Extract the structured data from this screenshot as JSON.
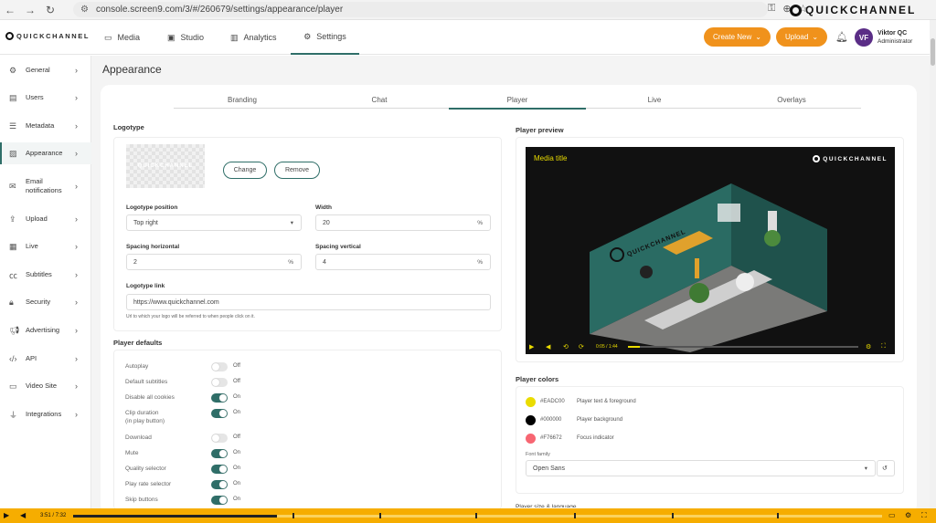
{
  "browser": {
    "url": "console.screen9.com/3/#/260679/settings/appearance/player",
    "watermark": "QUICKCHANNEL"
  },
  "brand": "QUICKCHANNEL",
  "nav": {
    "tabs": [
      "Media",
      "Studio",
      "Analytics",
      "Settings"
    ],
    "active": "Settings",
    "create": "Create New",
    "upload": "Upload"
  },
  "user": {
    "initials": "VF",
    "name": "Viktor QC",
    "role": "Administrator"
  },
  "sidebar": {
    "items": [
      {
        "label": "General",
        "icon": "gear-icon"
      },
      {
        "label": "Users",
        "icon": "users-icon"
      },
      {
        "label": "Metadata",
        "icon": "list-icon"
      },
      {
        "label": "Appearance",
        "icon": "image-icon"
      },
      {
        "label": "Email\nnotifications",
        "icon": "mail-icon"
      },
      {
        "label": "Upload",
        "icon": "upload-icon"
      },
      {
        "label": "Live",
        "icon": "live-icon"
      },
      {
        "label": "Subtitles",
        "icon": "cc-icon"
      },
      {
        "label": "Security",
        "icon": "lock-icon"
      },
      {
        "label": "Advertising",
        "icon": "megaphone-icon"
      },
      {
        "label": "API",
        "icon": "code-icon"
      },
      {
        "label": "Video Site",
        "icon": "monitor-icon"
      },
      {
        "label": "Integrations",
        "icon": "plug-icon"
      }
    ],
    "active": "Appearance"
  },
  "page": {
    "title": "Appearance"
  },
  "subtabs": [
    "Branding",
    "Chat",
    "Player",
    "Live",
    "Overlays"
  ],
  "subtab_active": "Player",
  "logotype": {
    "section": "Logotype",
    "placeholder": "QUICKCHANNEL",
    "change": "Change",
    "remove": "Remove",
    "position_label": "Logotype position",
    "position_value": "Top right",
    "width_label": "Width",
    "width_value": "20",
    "width_unit": "%",
    "sph_label": "Spacing horizontal",
    "sph_value": "2",
    "sph_unit": "%",
    "spv_label": "Spacing vertical",
    "spv_value": "4",
    "spv_unit": "%",
    "link_label": "Logotype link",
    "link_value": "https://www.quickchannel.com",
    "link_hint": "Url to which your logo will be referred to when people click on it."
  },
  "defaults": {
    "section": "Player defaults",
    "items": [
      {
        "label": "Autoplay",
        "on": false,
        "state": "Off"
      },
      {
        "label": "Default subtitles",
        "on": false,
        "state": "Off"
      },
      {
        "label": "Disable all cookies",
        "on": true,
        "state": "On"
      },
      {
        "label": "Clip duration\n(in play button)",
        "on": true,
        "state": "On"
      },
      {
        "label": "Download",
        "on": false,
        "state": "Off"
      },
      {
        "label": "Mute",
        "on": true,
        "state": "On"
      },
      {
        "label": "Quality selector",
        "on": true,
        "state": "On"
      },
      {
        "label": "Play rate selector",
        "on": true,
        "state": "On"
      },
      {
        "label": "Skip buttons",
        "on": true,
        "state": "On"
      }
    ]
  },
  "preview": {
    "section": "Player preview",
    "media_title": "Media title",
    "logo": "QUICKCHANNEL",
    "time": "0:05 / 1:44",
    "progress": 0.05
  },
  "colors": {
    "section": "Player colors",
    "items": [
      {
        "hex": "#EADC00",
        "label": "Player text & foreground",
        "color": "#EADC00"
      },
      {
        "hex": "#000000",
        "label": "Player background",
        "color": "#000000"
      },
      {
        "hex": "#F76672",
        "label": "Focus indicator",
        "color": "#F76672"
      }
    ],
    "font_label": "Font family",
    "font_value": "Open Sans"
  },
  "next_section": "Player size & language",
  "video": {
    "time": "3:51 / 7:32",
    "progress": 0.252
  }
}
